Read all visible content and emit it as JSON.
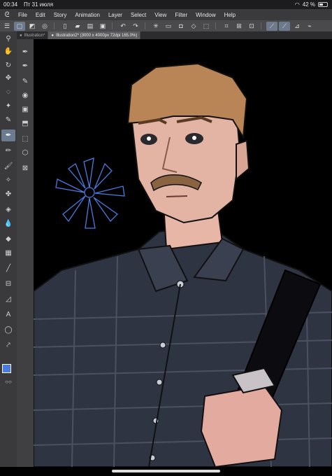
{
  "status": {
    "time": "00:34",
    "date": "Пт 31 июля",
    "battery_text": "42 %",
    "battery_level": 0.42
  },
  "menu": {
    "items": [
      "File",
      "Edit",
      "Story",
      "Animation",
      "Layer",
      "Select",
      "View",
      "Filter",
      "Window",
      "Help"
    ]
  },
  "tabs": [
    {
      "label": "Illustration*"
    },
    {
      "label": "Illustration2* (3000 x 4000px 72dpi 165.0%)"
    }
  ],
  "colors": {
    "main": "#4a7be0",
    "sub": "#f4c4b4",
    "ui_dark": "#3a3a3c",
    "active_tool": "#6b7b90"
  },
  "icons": {
    "left_toolbar": [
      "zoom-icon",
      "hand-icon",
      "rotate-icon",
      "move-icon",
      "lasso-icon",
      "select-wand-icon",
      "eyedropper-icon",
      "pen-icon",
      "pencil-icon",
      "brush-icon",
      "airbrush-icon",
      "decoration-icon",
      "eraser-icon",
      "blend-icon",
      "fill-icon",
      "gradient-icon",
      "figure-icon",
      "frame-icon",
      "ruler-icon",
      "text-icon",
      "balloon-icon",
      "correction-icon"
    ],
    "sub_toolbar": [
      "sub-tool-1-icon",
      "sub-tool-2-icon",
      "sub-tool-3-icon",
      "sub-tool-4-icon",
      "sub-tool-5-icon",
      "sub-tool-6-icon",
      "sub-tool-7-icon",
      "sub-tool-8-icon",
      "sub-tool-9-icon",
      "sub-tool-10-icon"
    ]
  }
}
